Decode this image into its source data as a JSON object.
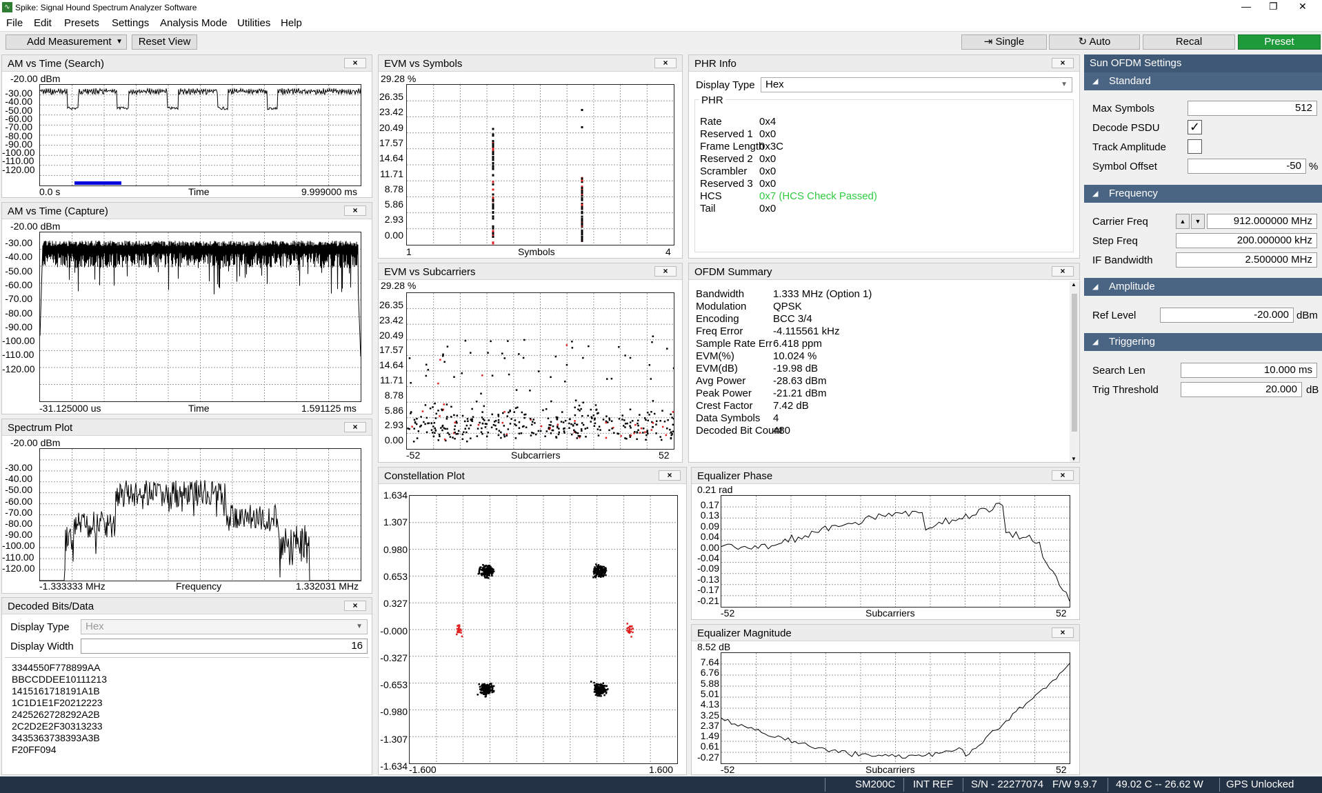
{
  "window": {
    "title": "Spike: Signal Hound Spectrum Analyzer Software"
  },
  "menu": [
    "File",
    "Edit",
    "Presets",
    "Settings",
    "Analysis Mode",
    "Utilities",
    "Help"
  ],
  "toolbar": {
    "add_measurement": "Add Measurement",
    "reset_view": "Reset View",
    "single": "Single",
    "auto": "Auto",
    "recal": "Recal",
    "preset": "Preset"
  },
  "close_glyph": "×",
  "panels": {
    "am_search": {
      "title": "AM vs Time (Search)",
      "top": "-20.00 dBm",
      "y_ticks": [
        "-30.00",
        "-40.00",
        "-50.00",
        "-60.00",
        "-70.00",
        "-80.00",
        "-90.00",
        "-100.00",
        "-110.00",
        "-120.00"
      ],
      "x_left": "0.0 s",
      "x_mid": "Time",
      "x_right": "9.999000 ms"
    },
    "am_capture": {
      "title": "AM vs Time (Capture)",
      "top": "-20.00 dBm",
      "y_ticks": [
        "-30.00",
        "-40.00",
        "-50.00",
        "-60.00",
        "-70.00",
        "-80.00",
        "-90.00",
        "-100.00",
        "-110.00",
        "-120.00"
      ],
      "x_left": "-31.125000 us",
      "x_mid": "Time",
      "x_right": "1.591125 ms"
    },
    "spectrum": {
      "title": "Spectrum Plot",
      "top": "-20.00 dBm",
      "y_ticks": [
        "-30.00",
        "-40.00",
        "-50.00",
        "-60.00",
        "-70.00",
        "-80.00",
        "-90.00",
        "-100.00",
        "-110.00",
        "-120.00"
      ],
      "x_left": "-1.333333 MHz",
      "x_mid": "Frequency",
      "x_right": "1.332031 MHz"
    },
    "evm_symbols": {
      "title": "EVM vs Symbols",
      "top": "29.28 %",
      "y_ticks": [
        "26.35",
        "23.42",
        "20.49",
        "17.57",
        "14.64",
        "11.71",
        "8.78",
        "5.86",
        "2.93",
        "0.00"
      ],
      "x_left": "1",
      "x_mid": "Symbols",
      "x_right": "4"
    },
    "evm_subcarriers": {
      "title": "EVM vs Subcarriers",
      "top": "29.28 %",
      "y_ticks": [
        "26.35",
        "23.42",
        "20.49",
        "17.57",
        "14.64",
        "11.71",
        "8.78",
        "5.86",
        "2.93",
        "0.00"
      ],
      "x_left": "-52",
      "x_mid": "Subcarriers",
      "x_right": "52"
    },
    "constellation": {
      "title": "Constellation Plot",
      "y_ticks": [
        "1.634",
        "1.307",
        "0.980",
        "0.653",
        "0.327",
        "-0.000",
        "-0.327",
        "-0.653",
        "-0.980",
        "-1.307",
        "-1.634"
      ],
      "x_left": "-1.600",
      "x_right": "1.600"
    },
    "eq_phase": {
      "title": "Equalizer Phase",
      "top": "0.21 rad",
      "y_ticks": [
        "0.17",
        "0.13",
        "0.09",
        "0.04",
        "0.00",
        "-0.04",
        "-0.09",
        "-0.13",
        "-0.17",
        "-0.21"
      ],
      "x_left": "-52",
      "x_mid": "Subcarriers",
      "x_right": "52"
    },
    "eq_mag": {
      "title": "Equalizer Magnitude",
      "top": "8.52 dB",
      "y_ticks": [
        "7.64",
        "6.76",
        "5.88",
        "5.01",
        "4.13",
        "3.25",
        "2.37",
        "1.49",
        "0.61",
        "-0.27"
      ],
      "x_left": "-52",
      "x_mid": "Subcarriers",
      "x_right": "52"
    }
  },
  "decoded": {
    "title": "Decoded Bits/Data",
    "display_type_label": "Display Type",
    "display_type_value": "Hex",
    "display_width_label": "Display Width",
    "display_width_value": "16",
    "lines": [
      "3344550F778899AA",
      "BBCCDDEE10111213",
      "1415161718191A1B",
      "1C1D1E1F20212223",
      "2425262728292A2B",
      "2C2D2E2F30313233",
      "3435363738393A3B",
      "F20FF094"
    ]
  },
  "phr": {
    "title": "PHR Info",
    "display_type_label": "Display Type",
    "display_type_value": "Hex",
    "group": "PHR",
    "rows": [
      {
        "k": "Rate",
        "v": "0x4"
      },
      {
        "k": "Reserved 1",
        "v": "0x0"
      },
      {
        "k": "Frame Length",
        "v": "0x3C"
      },
      {
        "k": "Reserved 2",
        "v": "0x0"
      },
      {
        "k": "Scrambler",
        "v": "0x0"
      },
      {
        "k": "Reserved 3",
        "v": "0x0"
      },
      {
        "k": "HCS",
        "v": "0x7 (HCS Check Passed)"
      },
      {
        "k": "Tail",
        "v": "0x0"
      }
    ],
    "pass_color": "#2ecc40"
  },
  "ofdm": {
    "title": "OFDM Summary",
    "rows": [
      {
        "k": "Bandwidth",
        "v": "1.333 MHz (Option 1)"
      },
      {
        "k": "Modulation",
        "v": "QPSK"
      },
      {
        "k": "Encoding",
        "v": "BCC 3/4"
      },
      {
        "k": "Freq Error",
        "v": "-4.115561 kHz"
      },
      {
        "k": "Sample Rate Err",
        "v": "6.418 ppm"
      },
      {
        "k": "EVM(%)",
        "v": "10.024 %"
      },
      {
        "k": "EVM(dB)",
        "v": "-19.98 dB"
      },
      {
        "k": "Avg Power",
        "v": "-28.63 dBm"
      },
      {
        "k": "Peak Power",
        "v": "-21.21 dBm"
      },
      {
        "k": "Crest Factor",
        "v": "7.42 dB"
      },
      {
        "k": "Data Symbols",
        "v": "4"
      },
      {
        "k": "Decoded Bit Count",
        "v": "480"
      }
    ]
  },
  "settings": {
    "title": "Sun OFDM Settings",
    "standard": {
      "label": "Standard",
      "max_symbols_label": "Max Symbols",
      "max_symbols": "512",
      "decode_psdu_label": "Decode PSDU",
      "decode_psdu": true,
      "track_amp_label": "Track Amplitude",
      "track_amp": false,
      "symbol_offset_label": "Symbol Offset",
      "symbol_offset": "-50",
      "symbol_offset_unit": "%"
    },
    "frequency": {
      "label": "Frequency",
      "carrier_label": "Carrier Freq",
      "carrier": "912.000000 MHz",
      "step_label": "Step Freq",
      "step": "200.000000 kHz",
      "ifbw_label": "IF Bandwidth",
      "ifbw": "2.500000 MHz"
    },
    "amplitude": {
      "label": "Amplitude",
      "ref_label": "Ref Level",
      "ref": "-20.000",
      "ref_unit": "dBm"
    },
    "triggering": {
      "label": "Triggering",
      "search_label": "Search Len",
      "search": "10.000 ms",
      "thresh_label": "Trig Threshold",
      "thresh": "20.000",
      "thresh_unit": "dB"
    }
  },
  "status": {
    "device": "SM200C",
    "ref": "INT REF",
    "serial": "S/N - 22277074",
    "fw": "F/W 9.9.7",
    "temp_power": "49.02 C  --  26.62 W",
    "gps": "GPS Unlocked"
  },
  "colors": {
    "accent_green": "#1f9a3a",
    "settings_header": "#3f5876",
    "section": "#4a6483",
    "status_bg": "#233244",
    "marker_blue": "#0000dd",
    "point_red": "#e02020"
  }
}
